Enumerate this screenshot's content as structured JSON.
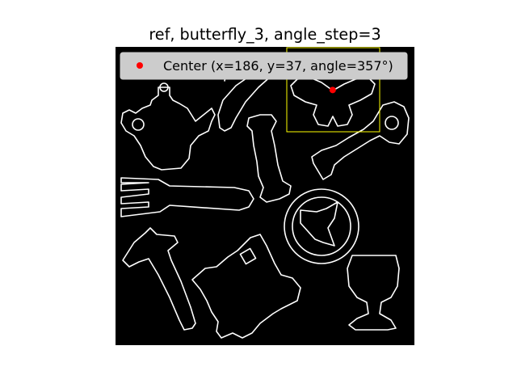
{
  "figure": {
    "title": "ref, butterfly_3, angle_step=3",
    "background": "#ffffff",
    "axes_background": "#000000"
  },
  "chart_data": {
    "type": "scatter",
    "title": "ref, butterfly_3, angle_step=3",
    "image": {
      "width": 256,
      "height": 256,
      "description_of_content": "binary edge image of silhouettes (teapot, banana, butterfly, key, candy, fork, steering wheel, hammer, train, goblet)",
      "shapes": [
        "teapot",
        "banana",
        "butterfly",
        "key",
        "candy",
        "fork",
        "steering-wheel",
        "hammer",
        "toy-train",
        "goblet"
      ]
    },
    "series": [
      {
        "name": "Center (x=186, y=37, angle=357°)",
        "type": "scatter",
        "color": "#ff0000",
        "x": [
          186
        ],
        "y": [
          37
        ]
      }
    ],
    "annotations": [
      {
        "type": "rectangle",
        "color": "#ffff00",
        "x0": 147,
        "y0": -1,
        "x1": 226,
        "y1": 73
      }
    ],
    "legend": {
      "placement": "top",
      "entries": [
        "Center (x=186, y=37, angle=357°)"
      ]
    },
    "axes_visible": false,
    "grid": false
  }
}
